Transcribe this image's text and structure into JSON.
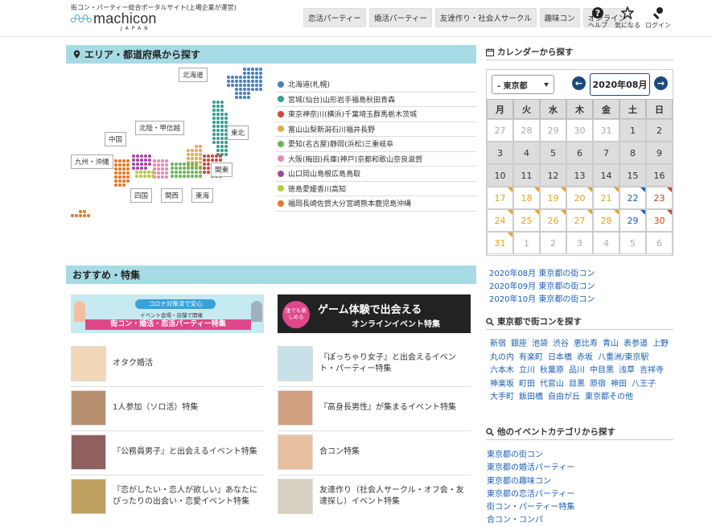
{
  "header": {
    "tagline": "街コン・パーティー総合ポータルサイト(上場企業が運営)",
    "logo_main": "machicon",
    "logo_sub": "JAPAN",
    "nav": [
      "恋活パーティー",
      "婚活パーティー",
      "友達作り・社会人サークル",
      "趣味コン",
      "オンライン"
    ],
    "help": "ヘルプ",
    "favorite": "気になる",
    "login": "ログイン"
  },
  "area_section": {
    "title": "エリア・都道府県から探す",
    "region_labels": [
      "北海道",
      "東北",
      "北陸・甲信越",
      "中国",
      "九州・沖縄",
      "関東",
      "四国",
      "関西",
      "東海"
    ],
    "prefecture_rows": [
      {
        "color": "#4a7fc0",
        "items": [
          "北海道",
          "(札幌)"
        ]
      },
      {
        "color": "#3aa090",
        "items": [
          "宮城",
          "(仙台)",
          "山形",
          "岩手",
          "福島",
          "秋田",
          "青森"
        ]
      },
      {
        "color": "#d0453a",
        "items": [
          "東京",
          "神奈川",
          "(横浜)",
          "千葉",
          "埼玉",
          "群馬",
          "栃木",
          "茨城"
        ]
      },
      {
        "color": "#e8a94a",
        "items": [
          "富山",
          "山梨",
          "新潟",
          "石川",
          "福井",
          "長野"
        ]
      },
      {
        "color": "#6ab45a",
        "items": [
          "愛知",
          "(名古屋)",
          "静岡",
          "(浜松)",
          "三重",
          "岐阜"
        ]
      },
      {
        "color": "#e88ab0",
        "items": [
          "大阪",
          "(梅田)",
          "兵庫",
          "(神戸)",
          "京都",
          "和歌山",
          "奈良",
          "滋賀"
        ]
      },
      {
        "color": "#a04aa0",
        "items": [
          "山口",
          "岡山",
          "島根",
          "広島",
          "鳥取"
        ]
      },
      {
        "color": "#b8c840",
        "items": [
          "徳島",
          "愛媛",
          "香川",
          "高知"
        ]
      },
      {
        "color": "#e07a2a",
        "items": [
          "福岡",
          "長崎",
          "佐賀",
          "大分",
          "宮崎",
          "熊本",
          "鹿児島",
          "沖縄"
        ]
      }
    ]
  },
  "feature_section": {
    "title": "おすすめ・特集",
    "banner1": {
      "line1": "コロナ対策済で安心",
      "line2": "イベント会場・店舗で開催",
      "line3": "街コン・婚活・恋活パーティー特集"
    },
    "banner2": {
      "badge": "誰でも楽しめる",
      "line1": "ゲーム体験で出会える",
      "line2": "オンラインイベント特集"
    },
    "items": [
      "オタク婚活",
      "『ぽっちゃり女子』と出会えるイベント・パーティー特集",
      "1人参加（ソロ活）特集",
      "『高身長男性』が集まるイベント特集",
      "『公務員男子』と出会えるイベント特集",
      "合コン特集",
      "『恋がしたい・恋人が欲しい』あなたにぴったりの出会い・恋愛イベント特集",
      "友達作り（社会人サークル・オフ会・友達探し）イベント特集"
    ]
  },
  "calendar": {
    "title": "カレンダーから探す",
    "prefecture": "- 東京都",
    "month": "2020年08月",
    "prev": "←",
    "next": "→",
    "weekdays": [
      "月",
      "火",
      "水",
      "木",
      "金",
      "土",
      "日"
    ],
    "days": [
      [
        "27",
        "28",
        "29",
        "30",
        "31",
        "1",
        "2"
      ],
      [
        "3",
        "4",
        "5",
        "6",
        "7",
        "8",
        "9"
      ],
      [
        "10",
        "11",
        "12",
        "13",
        "14",
        "15",
        "16"
      ],
      [
        "17",
        "18",
        "19",
        "20",
        "21",
        "22",
        "23"
      ],
      [
        "24",
        "25",
        "26",
        "27",
        "28",
        "29",
        "30"
      ],
      [
        "31",
        "1",
        "2",
        "3",
        "4",
        "5",
        "6"
      ]
    ]
  },
  "month_links": [
    "2020年08月 東京都の街コン",
    "2020年09月 東京都の街コン",
    "2020年10月 東京都の街コン"
  ],
  "tokyo_areas": {
    "title": "東京都で街コンを探す",
    "items": [
      "新宿",
      "銀座",
      "池袋",
      "渋谷",
      "恵比寿",
      "青山",
      "表参道",
      "上野",
      "丸の内",
      "有楽町",
      "日本橋",
      "赤坂",
      "八重洲/東京駅",
      "六本木",
      "立川",
      "秋葉原",
      "品川",
      "中目黒",
      "浅草",
      "吉祥寺",
      "神楽坂",
      "町田",
      "代官山",
      "目黒",
      "原宿",
      "神田",
      "八王子",
      "大手町",
      "飯田橋",
      "自由が丘",
      "東京都その他"
    ]
  },
  "other_categories": {
    "title": "他のイベントカテゴリから探す",
    "items": [
      "東京都の街コン",
      "東京都の婚活パーティー",
      "東京都の趣味コン",
      "東京都の恋活パーティー",
      "街コン・パーティー特集",
      "合コン・コンパ"
    ]
  }
}
